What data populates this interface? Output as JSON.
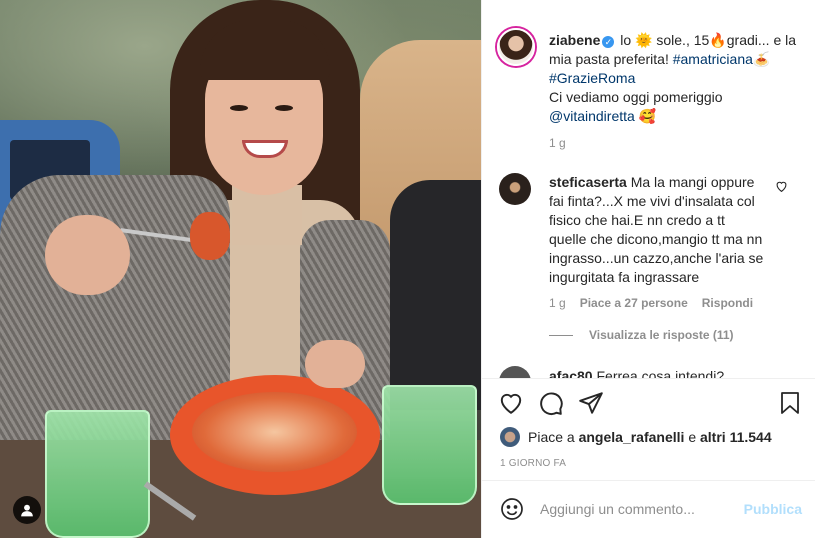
{
  "post": {
    "username": "ziabene",
    "caption_parts": {
      "p1": "lo",
      "p2": "sole., 15",
      "p3": "gradi... e la mia pasta preferita!",
      "hashtag1": "#amatriciana",
      "hashtag2": "#GrazieRoma",
      "line3": "Ci vediamo oggi pomeriggio",
      "mention": "@vitaindiretta"
    },
    "age": "1 g"
  },
  "comments": [
    {
      "username": "steficaserta",
      "text": "Ma la mangi oppure fai finta?...X me vivi d'insalata col fisico che hai.E nn credo a tt quelle che dicono,mangio tt ma nn ingrasso...un cazzo,anche l'aria se ingurgitata fa ingrassare",
      "age": "1 g",
      "likes": "Piace a 27 persone",
      "reply": "Rispondi",
      "view_replies": "Visualizza le risposte (11)"
    },
    {
      "username": "afac80",
      "text": "Ferrea cosa intendi?"
    }
  ],
  "likes": {
    "prefix": "Piace a",
    "user": "angela_rafanelli",
    "joiner": "e",
    "others": "altri 11.544"
  },
  "date": "1 GIORNO FA",
  "comment_box": {
    "placeholder": "Aggiungi un commento...",
    "publish": "Pubblica"
  },
  "icons": {
    "like": "heart-icon",
    "comment": "comment-icon",
    "share": "share-icon",
    "save": "bookmark-icon",
    "emoji": "emoji-icon",
    "user_tag": "user-tag-icon"
  },
  "colors": {
    "link": "#00376b",
    "muted": "#8e8e8e",
    "verified": "#3897f0",
    "publish_disabled": "#b2dffc"
  }
}
